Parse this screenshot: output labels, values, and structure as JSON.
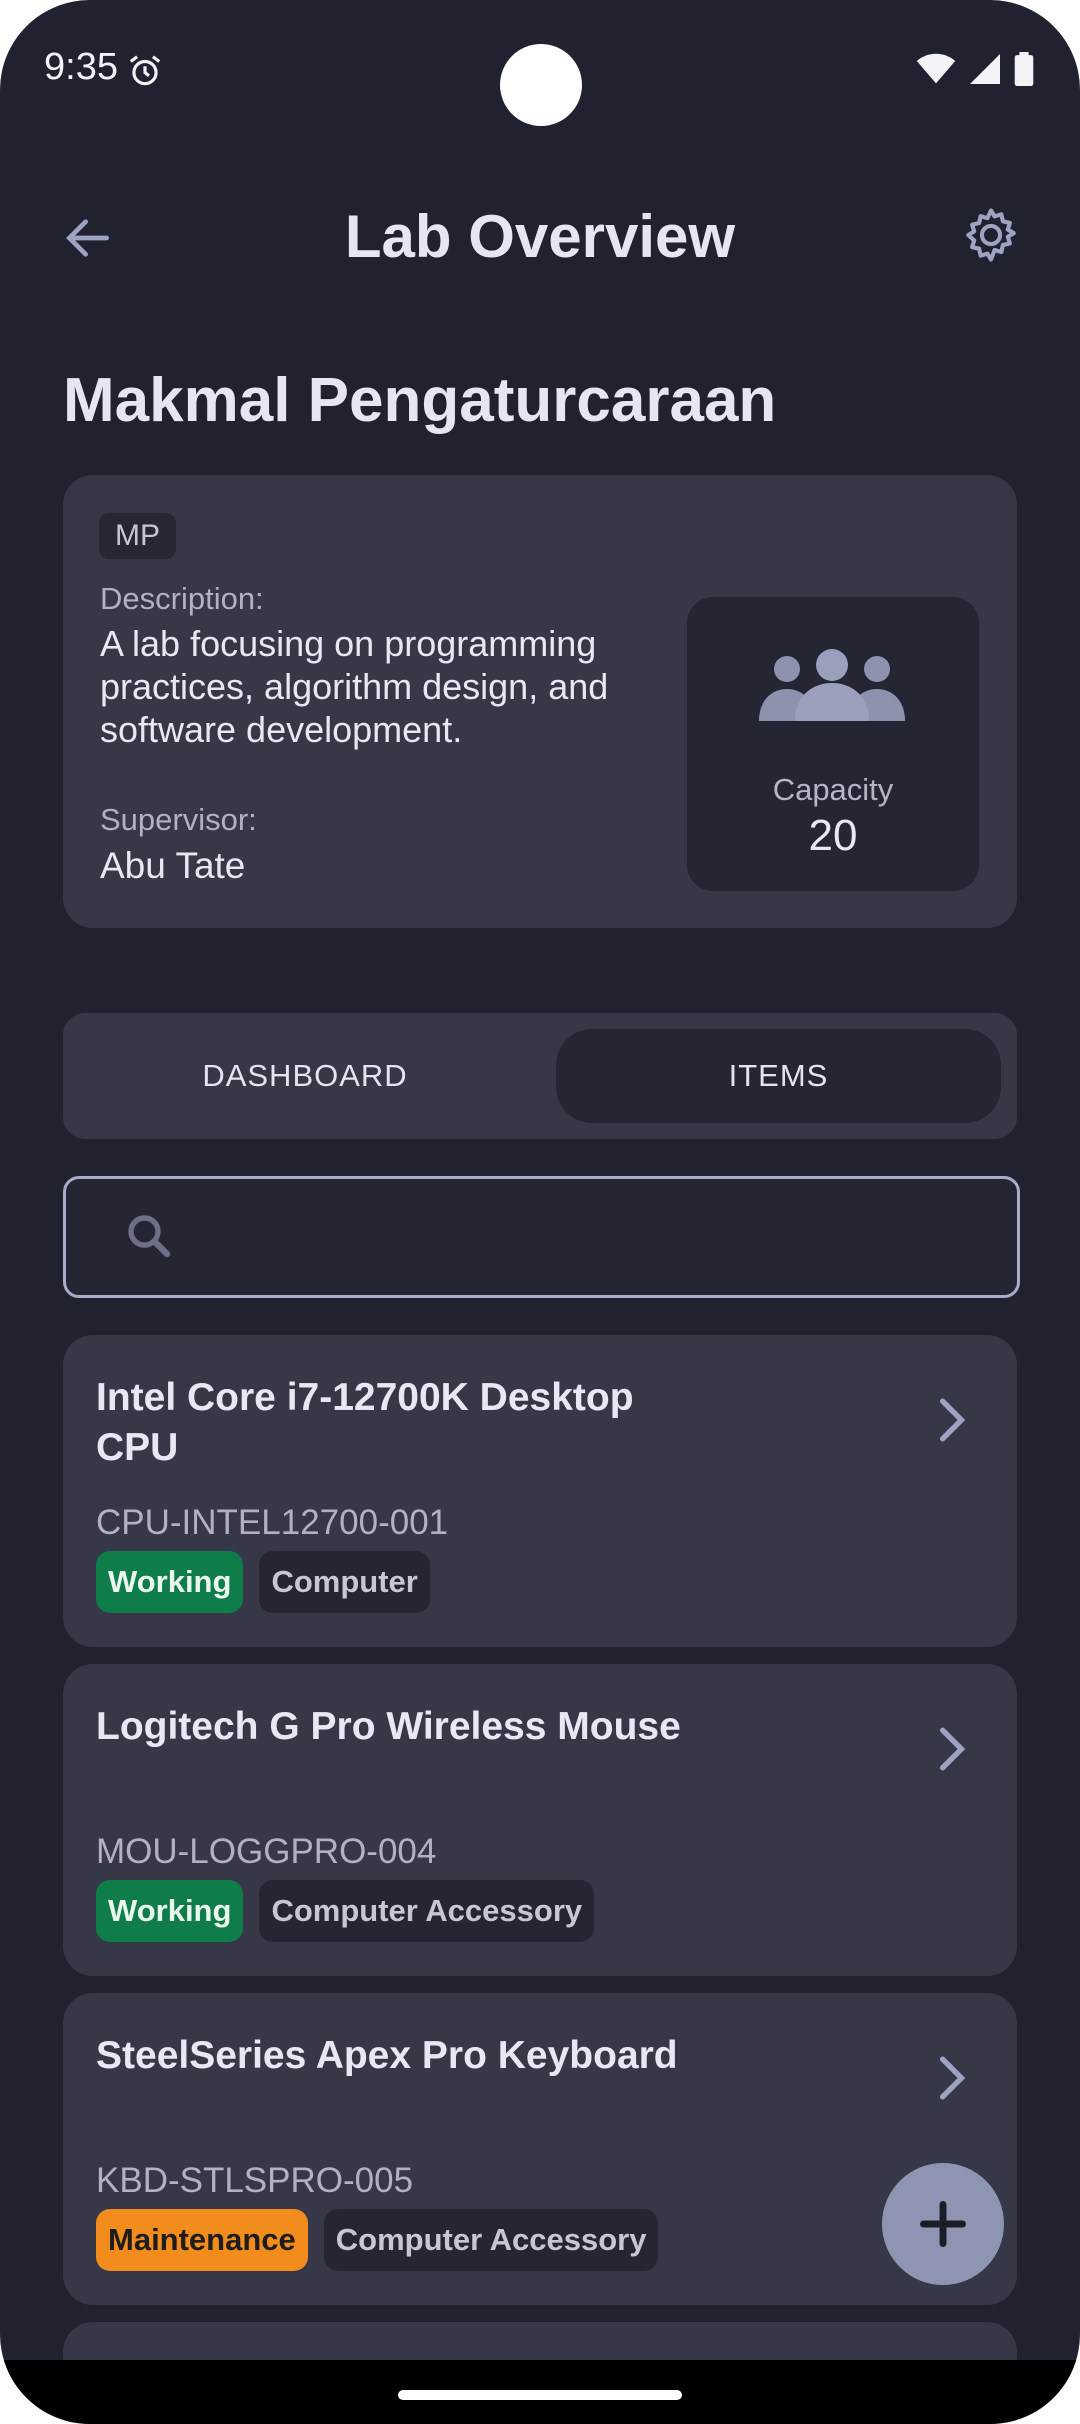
{
  "status_bar": {
    "time": "9:35",
    "icons": [
      "alarm-icon",
      "wifi-icon",
      "signal-icon",
      "battery-icon"
    ]
  },
  "app_bar": {
    "title": "Lab Overview",
    "back_icon": "arrow-left-icon",
    "settings_icon": "gear-icon"
  },
  "lab": {
    "name": "Makmal Pengaturcaraan",
    "code": "MP",
    "description_label": "Description:",
    "description": "A lab focusing on programming practices, algorithm design, and software development.",
    "supervisor_label": "Supervisor:",
    "supervisor": "Abu Tate",
    "capacity_label": "Capacity",
    "capacity": "20"
  },
  "tabs": [
    {
      "label": "DASHBOARD",
      "selected": false
    },
    {
      "label": "ITEMS",
      "selected": true
    }
  ],
  "search": {
    "value": "",
    "placeholder": ""
  },
  "items": [
    {
      "name": "Intel Core i7-12700K Desktop CPU",
      "code": "CPU-INTEL12700-001",
      "status": "Working",
      "category": "Computer"
    },
    {
      "name": "Logitech G Pro Wireless Mouse",
      "code": "MOU-LOGGPRO-004",
      "status": "Working",
      "category": "Computer Accessory"
    },
    {
      "name": "SteelSeries Apex Pro Keyboard",
      "code": "KBD-STLSPRO-005",
      "status": "Maintenance",
      "category": "Computer Accessory"
    }
  ],
  "colors": {
    "background": "#21222f",
    "card": "#363848",
    "status_working": "#0f7d4a",
    "status_maintenance": "#f28c1c",
    "fab": "#8e95b2"
  }
}
